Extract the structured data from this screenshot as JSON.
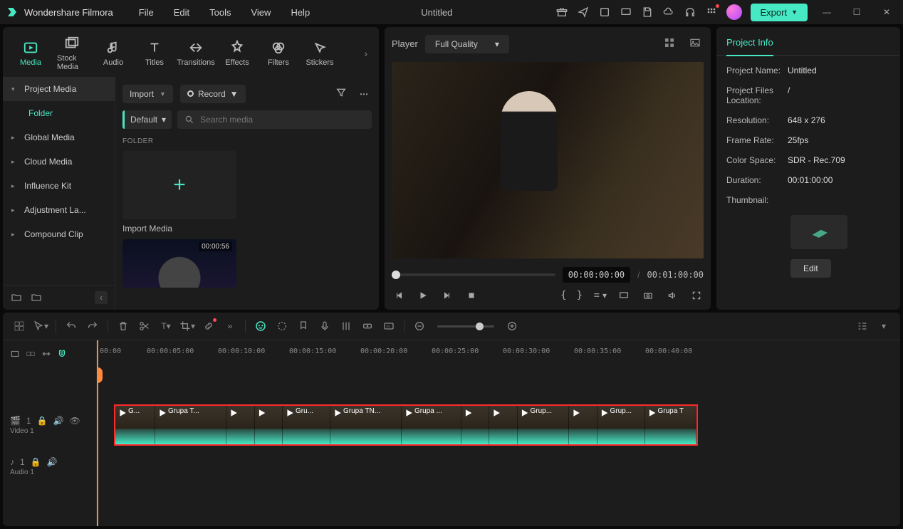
{
  "app": {
    "name": "Wondershare Filmora",
    "title": "Untitled"
  },
  "menu": [
    "File",
    "Edit",
    "Tools",
    "View",
    "Help"
  ],
  "export": {
    "label": "Export"
  },
  "tabs": [
    {
      "label": "Media",
      "active": true
    },
    {
      "label": "Stock Media"
    },
    {
      "label": "Audio"
    },
    {
      "label": "Titles"
    },
    {
      "label": "Transitions"
    },
    {
      "label": "Effects"
    },
    {
      "label": "Filters"
    },
    {
      "label": "Stickers"
    }
  ],
  "sidebar": {
    "items": [
      {
        "label": "Project Media",
        "expanded": true
      },
      {
        "label": "Global Media"
      },
      {
        "label": "Cloud Media"
      },
      {
        "label": "Influence Kit"
      },
      {
        "label": "Adjustment La..."
      },
      {
        "label": "Compound Clip"
      }
    ],
    "sub": "Folder"
  },
  "media": {
    "import": "Import",
    "record": "Record",
    "sort": "Default",
    "search_placeholder": "Search media",
    "folder_label": "FOLDER",
    "import_media": "Import Media",
    "clip_duration": "00:00:56"
  },
  "player": {
    "label": "Player",
    "quality": "Full Quality",
    "current": "00:00:00:00",
    "total": "00:01:00:00"
  },
  "info": {
    "tab": "Project Info",
    "rows": [
      {
        "key": "Project Name:",
        "val": "Untitled"
      },
      {
        "key": "Project Files Location:",
        "val": "/"
      },
      {
        "key": "Resolution:",
        "val": "648 x 276"
      },
      {
        "key": "Frame Rate:",
        "val": "25fps"
      },
      {
        "key": "Color Space:",
        "val": "SDR - Rec.709"
      },
      {
        "key": "Duration:",
        "val": "00:01:00:00"
      },
      {
        "key": "Thumbnail:",
        "val": ""
      }
    ],
    "edit": "Edit"
  },
  "timeline": {
    "ticks": [
      "00:00",
      "00:00:05:00",
      "00:00:10:00",
      "00:00:15:00",
      "00:00:20:00",
      "00:00:25:00",
      "00:00:30:00",
      "00:00:35:00",
      "00:00:40:00"
    ],
    "video_track": {
      "label": "Video 1",
      "index": "1"
    },
    "audio_track": {
      "label": "Audio 1",
      "index": "1"
    },
    "clips": [
      {
        "name": "G..."
      },
      {
        "name": "Grupa T..."
      },
      {
        "name": ""
      },
      {
        "name": ""
      },
      {
        "name": "Gru..."
      },
      {
        "name": "Grupa TN..."
      },
      {
        "name": "Grupa ..."
      },
      {
        "name": ""
      },
      {
        "name": ""
      },
      {
        "name": "Grup..."
      },
      {
        "name": ""
      },
      {
        "name": "Grup..."
      },
      {
        "name": "Grupa T"
      }
    ]
  }
}
